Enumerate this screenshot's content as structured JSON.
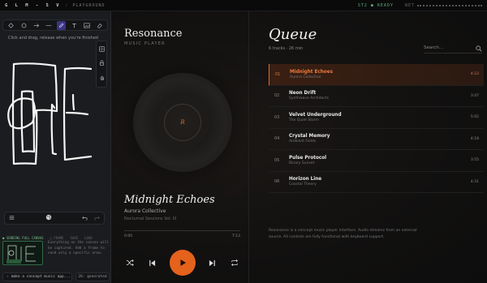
{
  "topbar": {
    "logo": "G L M - 5 V",
    "separator": "/",
    "page": "PLAYGROUND",
    "status": "ST2 ● READY",
    "net_label": "NET"
  },
  "canvas": {
    "hint": "Click and drag, release when you're finished",
    "tools": [
      "diamond-icon",
      "circle-icon",
      "arrow-icon",
      "line-icon",
      "pencil-icon",
      "text-icon",
      "image-icon",
      "eraser-icon"
    ],
    "side_tools": [
      "grid-icon",
      "lock-icon",
      "hand-icon"
    ],
    "send_label": "● SENDING FULL CANVAS",
    "send_options": [
      "□ FRAME",
      "SAVE",
      "LOAD"
    ],
    "thumb_text": "Everything on the canvas will be captured. Add a frame to send only a specific area.",
    "prompt_prefix": "›",
    "prompt_text": "make a concept music app...",
    "gen_label": "26: generated"
  },
  "player": {
    "brand": "Resonance",
    "brand_sub": "MUSIC PLAYER",
    "disc_label": "R",
    "now_playing": {
      "title": "Midnight Echoes",
      "artist": "Aurora Collective",
      "album": "Nocturnal Sessions Vol. III",
      "elapsed": "0:00",
      "duration": "7:13",
      "progress": 0.0
    },
    "accent": "#e5621d"
  },
  "queue": {
    "title": "Queue",
    "meta": "6 tracks · 26 min",
    "search_placeholder": "Search...",
    "tracks": [
      {
        "num": "01",
        "name": "Midnight Echoes",
        "artist": "Aurora Collective",
        "dur": "4:23"
      },
      {
        "num": "02",
        "name": "Neon Drift",
        "artist": "Synthwave Architects",
        "dur": "3:47"
      },
      {
        "num": "03",
        "name": "Velvet Underground",
        "artist": "The Quiet Storm",
        "dur": "5:02"
      },
      {
        "num": "04",
        "name": "Crystal Memory",
        "artist": "Ambient Fields",
        "dur": "4:18"
      },
      {
        "num": "05",
        "name": "Pulse Protocol",
        "artist": "Binary Sunset",
        "dur": "3:55"
      },
      {
        "num": "06",
        "name": "Horizon Line",
        "artist": "Coastal Theory",
        "dur": "4:31"
      }
    ],
    "footer": "Resonance is a concept music player interface. Audio streams from an external source. All controls are fully functional with keyboard support."
  }
}
